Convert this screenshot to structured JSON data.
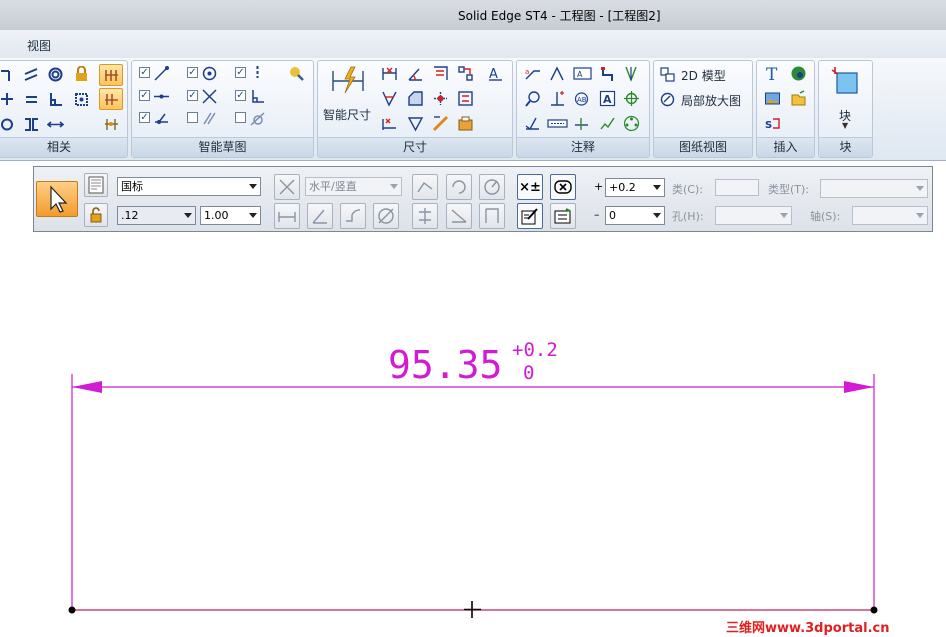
{
  "window": {
    "title": "Solid Edge ST4 - 工程图 - [工程图2]"
  },
  "menu": {
    "view": "视图"
  },
  "ribbon": {
    "groups": {
      "relate": "相关",
      "sketch": "智能草图",
      "dimension": "尺寸",
      "annotation": "注释",
      "drawing_views": "图纸视图",
      "insert": "插入",
      "block": "块"
    },
    "smart_dimension_label": "智能尺寸",
    "model_2d_label": "2D 模型",
    "detail_view_label": "局部放大图",
    "block_button_label": "块"
  },
  "command_bar": {
    "style_value": "国标",
    "alignment_value": "水平/竖直",
    "precision_value": ".12",
    "scale_value": "1.00",
    "plus_sign": "+",
    "minus_sign": "–",
    "upper_tol_value": "+0.2",
    "lower_tol_value": "0",
    "class_label": "类(C):",
    "type_label": "类型(T):",
    "hole_label": "孔(H):",
    "shaft_label": "轴(S):"
  },
  "drawing": {
    "dimension_value": "95.35",
    "upper_tolerance": "+0.2",
    "lower_tolerance": "0"
  },
  "colors": {
    "dimension": "#d21bd2",
    "edge": "#c0205a",
    "accent": "#f39b2d"
  },
  "watermark": "三维网www.3dportal.cn"
}
